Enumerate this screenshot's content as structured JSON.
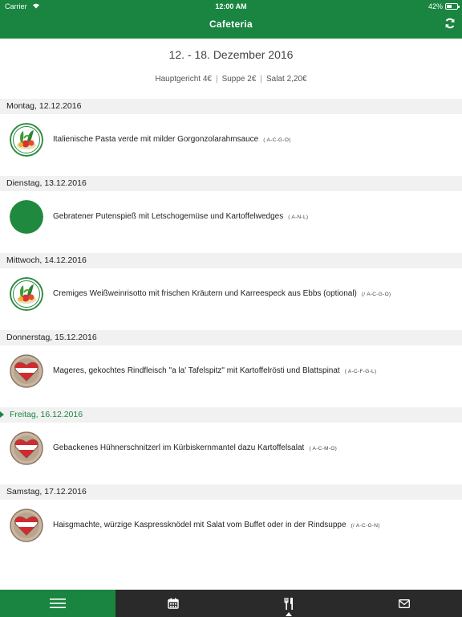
{
  "status": {
    "carrier": "Carrier",
    "time": "12:00 AM",
    "battery": "42%"
  },
  "nav": {
    "title": "Cafeteria"
  },
  "week": {
    "range": "12. - 18. Dezember 2016",
    "prices": [
      "Hauptgericht 4€",
      "Suppe 2€",
      "Salat 2,20€"
    ]
  },
  "days": [
    {
      "date": "Montag, 12.12.2016",
      "meal": "Italienische Pasta verde mit milder Gorgonzolarahmsauce",
      "codes": "( A-C-G-O)",
      "icon": "vegetarian-icon",
      "active": false
    },
    {
      "date": "Dienstag, 13.12.2016",
      "meal": "Gebratener Putenspieß mit Letschogemüse und Kartoffelwedges",
      "codes": "( A-N-L)",
      "icon": "green-dot-icon",
      "active": false
    },
    {
      "date": "Mittwoch, 14.12.2016",
      "meal": "Cremiges Weißweinrisotto mit frischen Kräutern und Karreespeck aus Ebbs (optional)",
      "codes": "(/ A-C-G-O)",
      "icon": "vegetarian-icon",
      "active": false
    },
    {
      "date": "Donnerstag, 15.12.2016",
      "meal": "Mageres, gekochtes Rindfleisch \"a la' Tafelspitz\" mit Kartoffelrösti und Blattspinat",
      "codes": "( A-C-F-G-L)",
      "icon": "austria-heart-icon",
      "active": false
    },
    {
      "date": "Freitag, 16.12.2016",
      "meal": "Gebackenes Hühnerschnitzerl im Kürbiskernmantel dazu Kartoffelsalat",
      "codes": "( A-C-M-O)",
      "icon": "austria-heart-icon",
      "active": true
    },
    {
      "date": "Samstag, 17.12.2016",
      "meal": "Haisgmachte, würzige Kaspressknödel mit Salat vom Buffet oder in der Rindsuppe",
      "codes": "(/ A-C-G-N)",
      "icon": "austria-heart-icon",
      "active": false
    }
  ],
  "tabs": [
    {
      "name": "menu-tab",
      "icon": "hamburger-icon",
      "active": true
    },
    {
      "name": "calendar-tab",
      "icon": "calendar-icon",
      "active": false
    },
    {
      "name": "cafeteria-tab",
      "icon": "fork-knife-icon",
      "active": false
    },
    {
      "name": "mail-tab",
      "icon": "envelope-icon",
      "active": false
    }
  ],
  "colors": {
    "brand": "#1a8540",
    "tabbar": "#2a2a2a",
    "day_header_bg": "#f1f1f1",
    "austria_red": "#d12a2f"
  }
}
